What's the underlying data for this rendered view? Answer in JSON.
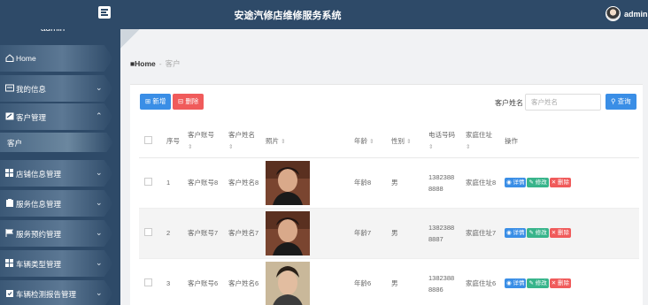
{
  "header": {
    "title": "安途汽修店维修服务系统",
    "username": "admin"
  },
  "sidebar": {
    "username": "admin",
    "items": [
      {
        "label": "Home",
        "icon": "home-icon"
      },
      {
        "label": "我的信息",
        "icon": "id-card-icon"
      },
      {
        "label": "客户管理",
        "icon": "edit-icon",
        "expanded": true
      },
      {
        "label": "客户",
        "sub": true
      },
      {
        "label": "店铺信息管理",
        "icon": "grid-icon"
      },
      {
        "label": "服务信息管理",
        "icon": "clipboard-icon"
      },
      {
        "label": "服务预约管理",
        "icon": "flag-icon"
      },
      {
        "label": "车辆类型管理",
        "icon": "grid-icon"
      },
      {
        "label": "车辆检测报告管理",
        "icon": "clipboard-check-icon"
      }
    ]
  },
  "breadcrumb": {
    "home": "Home",
    "separator": "-",
    "current": "客户"
  },
  "toolbar": {
    "add_label": "新增",
    "delete_label": "删除",
    "search_label": "客户姓名",
    "search_placeholder": "客户姓名",
    "search_button": "查询"
  },
  "table": {
    "headers": {
      "index": "序号",
      "account": "客户账号",
      "name": "客户姓名",
      "photo": "照片",
      "age": "年龄",
      "gender": "性别",
      "phone": "电话号码",
      "address": "家庭住址",
      "actions": "操作"
    },
    "sort_glyph": "⇕",
    "actions": {
      "detail": "详情",
      "edit": "修改",
      "remove": "删除"
    },
    "rows": [
      {
        "index": "1",
        "account": "客户账号8",
        "name": "客户姓名8",
        "age": "年龄8",
        "gender": "男",
        "phone1": "1382388",
        "phone2": "8888",
        "address": "家庭住址8"
      },
      {
        "index": "2",
        "account": "客户账号7",
        "name": "客户姓名7",
        "age": "年龄7",
        "gender": "男",
        "phone1": "1382388",
        "phone2": "8887",
        "address": "家庭住址7"
      },
      {
        "index": "3",
        "account": "客户账号6",
        "name": "客户姓名6",
        "age": "年龄6",
        "gender": "男",
        "phone1": "1382388",
        "phone2": "8886",
        "address": "家庭住址6"
      }
    ]
  },
  "colors": {
    "sidebar": "#2e4a68",
    "primary": "#3a8ee6",
    "danger": "#f05b5b",
    "success": "#38b48b"
  }
}
